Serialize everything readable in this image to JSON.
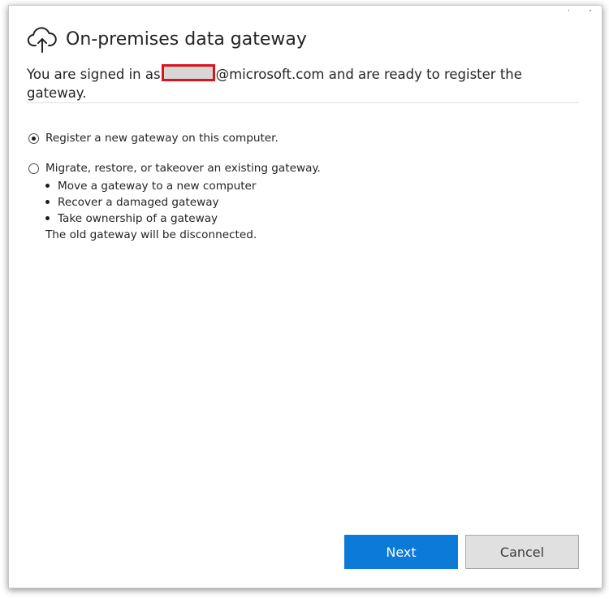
{
  "window": {
    "controls": [
      {
        "icon": "minimize-icon",
        "glyph": "˙"
      },
      {
        "icon": "close-icon",
        "glyph": "ˊ"
      }
    ]
  },
  "header": {
    "icon": "cloud-upload-icon",
    "title": "On-premises data gateway"
  },
  "signed_in": {
    "prefix": "You are signed in as",
    "redacted": "",
    "suffix": "@microsoft.com and are ready to register the gateway."
  },
  "options": {
    "register": {
      "label": "Register a new gateway on this computer.",
      "selected": true
    },
    "migrate": {
      "label": "Migrate, restore, or takeover an existing gateway.",
      "selected": false,
      "bullets": [
        "Move a gateway to a new computer",
        "Recover a damaged gateway",
        "Take ownership of a gateway"
      ],
      "note": "The old gateway will be disconnected."
    }
  },
  "buttons": {
    "next": "Next",
    "cancel": "Cancel"
  },
  "colors": {
    "accent": "#0b7ad8",
    "redaction_border": "#e0111b",
    "cancel_bg": "#e0e0e0"
  }
}
